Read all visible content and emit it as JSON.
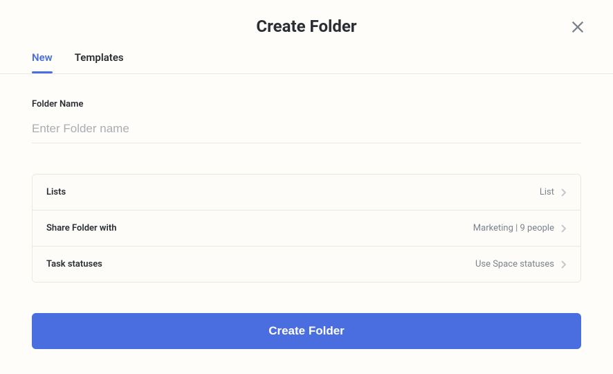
{
  "header": {
    "title": "Create Folder"
  },
  "tabs": {
    "new": "New",
    "templates": "Templates"
  },
  "form": {
    "folder_name_label": "Folder Name",
    "folder_name_placeholder": "Enter Folder name",
    "folder_name_value": ""
  },
  "options": [
    {
      "label": "Lists",
      "value": "List"
    },
    {
      "label": "Share Folder with",
      "value": "Marketing | 9 people"
    },
    {
      "label": "Task statuses",
      "value": "Use Space statuses"
    }
  ],
  "submit": {
    "label": "Create Folder"
  }
}
